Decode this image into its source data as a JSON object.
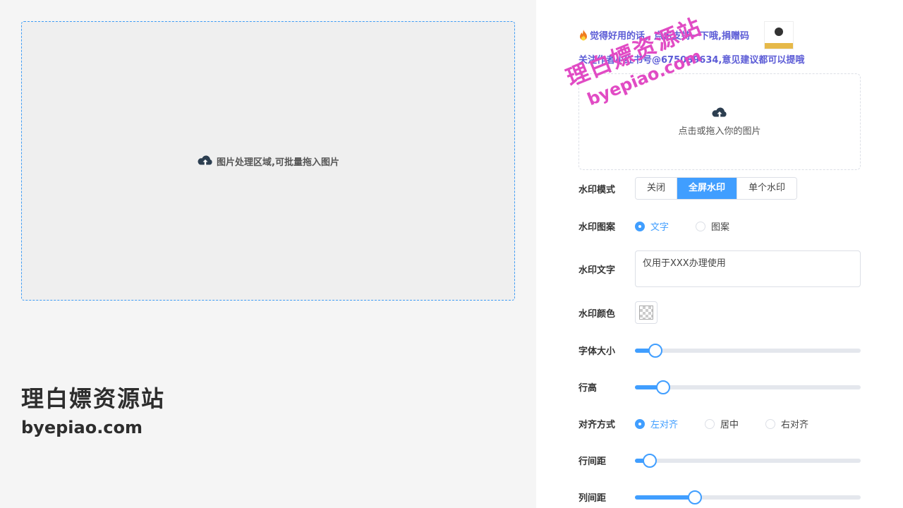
{
  "drop_area": {
    "text": "图片处理区域,可批量拖入图片",
    "icon": "cloud-upload-icon"
  },
  "brand": {
    "cn": "理白嫖资源站",
    "en": "byepiao.com"
  },
  "overlay": {
    "cn": "理白嫖资源站",
    "en": "byepiao.com",
    "color": "#e14bc4"
  },
  "promo": {
    "line1": "觉得好用的话，点击支持一下哦,捐赠码",
    "line2": "关注作者小红书号@675089634,意见建议都可以提哦"
  },
  "upload": {
    "text": "点击或拖入你的图片",
    "icon": "cloud-upload-icon"
  },
  "form": {
    "mode": {
      "label": "水印模式",
      "options": [
        "关闭",
        "全屏水印",
        "单个水印"
      ],
      "selected": "全屏水印"
    },
    "pattern": {
      "label": "水印图案",
      "options": [
        "文字",
        "图案"
      ],
      "selected": "文字"
    },
    "text": {
      "label": "水印文字",
      "value": "仅用于XXX办理使用"
    },
    "color": {
      "label": "水印颜色"
    },
    "font_size": {
      "label": "字体大小",
      "percent": 9
    },
    "line_height": {
      "label": "行高",
      "percent": 12.5
    },
    "align": {
      "label": "对齐方式",
      "options": [
        "左对齐",
        "居中",
        "右对齐"
      ],
      "selected": "左对齐"
    },
    "row_gap": {
      "label": "行间距",
      "percent": 6.5
    },
    "col_gap": {
      "label": "列间距",
      "percent": 26.5
    }
  },
  "colors": {
    "accent": "#409eff",
    "promo": "#5b5bd6"
  }
}
